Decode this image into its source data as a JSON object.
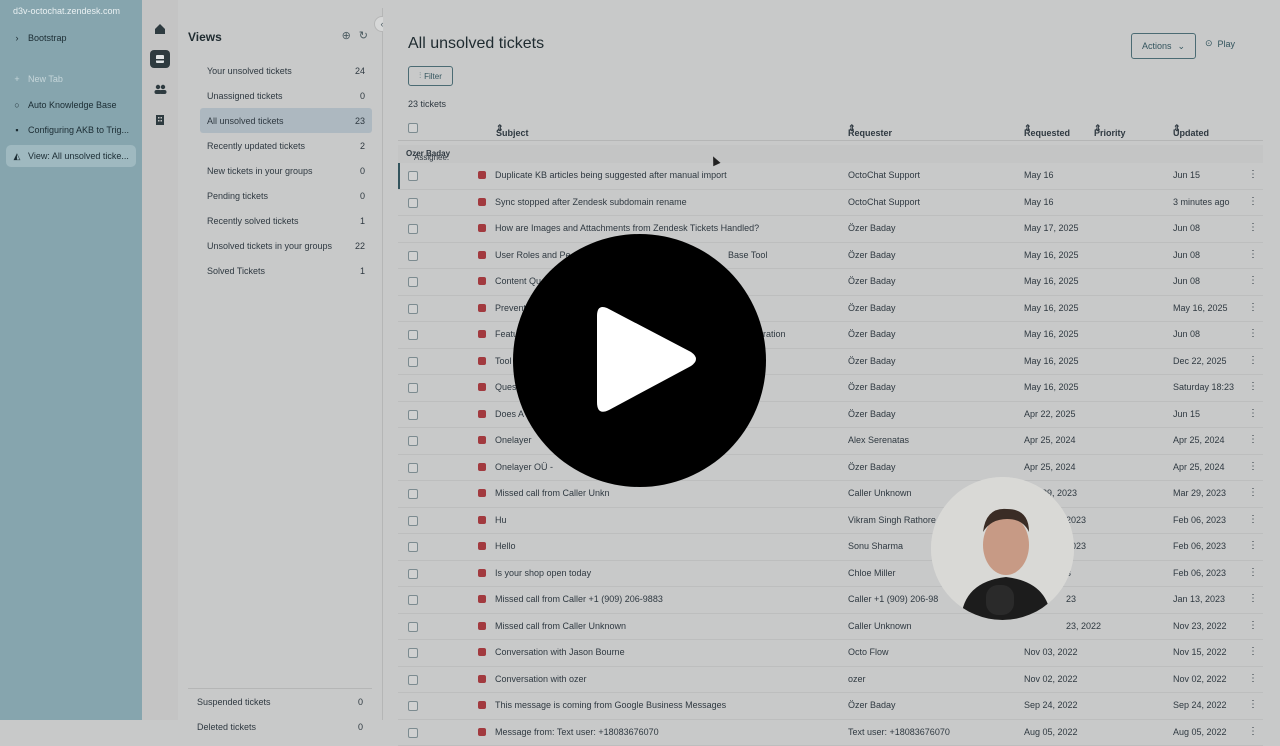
{
  "browser": {
    "url": "d3v-octochat.zendesk.com",
    "tabs": [
      {
        "label": "Bootstrap",
        "icon": "chevron-right-icon"
      },
      {
        "label": "New Tab",
        "icon": "plus-icon"
      },
      {
        "label": "Auto Knowledge Base",
        "icon": "circle-icon"
      },
      {
        "label": "Configuring AKB to Trig...",
        "icon": "doc-icon"
      },
      {
        "label": "View: All unsolved ticke...",
        "icon": "zendesk-icon"
      }
    ]
  },
  "views_panel": {
    "title": "Views",
    "items": [
      {
        "label": "Your unsolved tickets",
        "count": "24"
      },
      {
        "label": "Unassigned tickets",
        "count": "0"
      },
      {
        "label": "All unsolved tickets",
        "count": "23"
      },
      {
        "label": "Recently updated tickets",
        "count": "2"
      },
      {
        "label": "New tickets in your groups",
        "count": "0"
      },
      {
        "label": "Pending tickets",
        "count": "0"
      },
      {
        "label": "Recently solved tickets",
        "count": "1"
      },
      {
        "label": "Unsolved tickets in your groups",
        "count": "22"
      },
      {
        "label": "Solved Tickets",
        "count": "1"
      }
    ],
    "bottom": [
      {
        "label": "Suspended tickets",
        "count": "0"
      },
      {
        "label": "Deleted tickets",
        "count": "0"
      }
    ]
  },
  "main": {
    "title": "All unsolved tickets",
    "actions_label": "Actions",
    "play_label": "Play",
    "filter_label": "Filter",
    "ticket_count": "23 tickets",
    "columns": {
      "subject": "Subject",
      "requester": "Requester",
      "requested": "Requested",
      "priority": "Priority",
      "updated": "Updated"
    },
    "group_label": "Assignee:",
    "group_value": "Ozer Baday",
    "rows": [
      {
        "subject": "Duplicate KB articles being suggested after manual import",
        "requester": "OctoChat Support",
        "requested": "May 16",
        "updated": "Jun 15"
      },
      {
        "subject": "Sync stopped after Zendesk subdomain rename",
        "requester": "OctoChat Support",
        "requested": "May 16",
        "updated": "3 minutes ago"
      },
      {
        "subject": "How are Images and Attachments from Zendesk Tickets Handled?",
        "requester": "Özer Baday",
        "requested": "May 17, 2025",
        "updated": "Jun 08"
      },
      {
        "subject": "User Roles and Pe",
        "subject_tail": "Base Tool",
        "requester": "Özer Baday",
        "requested": "May 16, 2025",
        "updated": "Jun 08"
      },
      {
        "subject": "Content Qu",
        "subject_tail": "",
        "requester": "Özer Baday",
        "requested": "May 16, 2025",
        "updated": "Jun 08"
      },
      {
        "subject": "Prevent",
        "subject_tail": "",
        "requester": "Özer Baday",
        "requested": "May 16, 2025",
        "updated": "May 16, 2025"
      },
      {
        "subject": "Featu",
        "subject_tail": "ration",
        "requester": "Özer Baday",
        "requested": "May 16, 2025",
        "updated": "Jun 08"
      },
      {
        "subject": "Tool",
        "subject_tail": "",
        "requester": "Özer Baday",
        "requested": "May 16, 2025",
        "updated": "Dec 22, 2025"
      },
      {
        "subject": "Ques",
        "subject_tail": "",
        "requester": "Özer Baday",
        "requested": "May 16, 2025",
        "updated": "Saturday 18:23"
      },
      {
        "subject": "Does A",
        "subject_tail": "",
        "requester": "Özer Baday",
        "requested": "Apr 22, 2025",
        "updated": "Jun 15"
      },
      {
        "subject": "Onelayer",
        "subject_tail": "",
        "requester": "Alex Serenatas",
        "requested": "Apr 25, 2024",
        "updated": "Apr 25, 2024"
      },
      {
        "subject": "Onelayer OÜ -",
        "subject_tail": "",
        "requester": "Özer Baday",
        "requested": "Apr 25, 2024",
        "updated": "Apr 25, 2024"
      },
      {
        "subject": "Missed call from Caller Unkn",
        "subject_tail": "",
        "requester": "Caller Unknown",
        "requested": "Mar 29, 2023",
        "updated": "Mar 29, 2023"
      },
      {
        "subject": "Hu",
        "subject_tail": "",
        "requester": "Vikram Singh Rathore (V",
        "requested": "2023",
        "updated": "Feb 06, 2023"
      },
      {
        "subject": "Hello",
        "subject_tail": "",
        "requester": "Sonu Sharma",
        "requested": "2023",
        "updated": "Feb 06, 2023"
      },
      {
        "subject": "Is your shop open today",
        "subject_tail": "",
        "requester": "Chloe Miller",
        "requested": "3",
        "updated": "Feb 06, 2023"
      },
      {
        "subject": "Missed call from Caller +1 (909) 206-9883",
        "subject_tail": "",
        "requester": "Caller +1 (909) 206-98",
        "requested": "23",
        "updated": "Jan 13, 2023"
      },
      {
        "subject": "Missed call from Caller Unknown",
        "subject_tail": "",
        "requester": "Caller Unknown",
        "requested": "23, 2022",
        "updated": "Nov 23, 2022"
      },
      {
        "subject": "Conversation with Jason Bourne",
        "subject_tail": "",
        "requester": "Octo Flow",
        "requested": "Nov 03, 2022",
        "updated": "Nov 15, 2022"
      },
      {
        "subject": "Conversation with ozer",
        "subject_tail": "",
        "requester": "ozer",
        "requested": "Nov 02, 2022",
        "updated": "Nov 02, 2022"
      },
      {
        "subject": "This message is coming from Google Business Messages",
        "subject_tail": "",
        "requester": "Özer Baday",
        "requested": "Sep 24, 2022",
        "updated": "Sep 24, 2022"
      },
      {
        "subject": "Message from: Text user: +18083676070",
        "subject_tail": "",
        "requester": "Text user: +18083676070",
        "requested": "Aug 05, 2022",
        "updated": "Aug 05, 2022"
      }
    ]
  },
  "colors": {
    "ticket_badge": "#a23a3f",
    "active_view": "#adb8c0",
    "overlay": "#000000"
  }
}
